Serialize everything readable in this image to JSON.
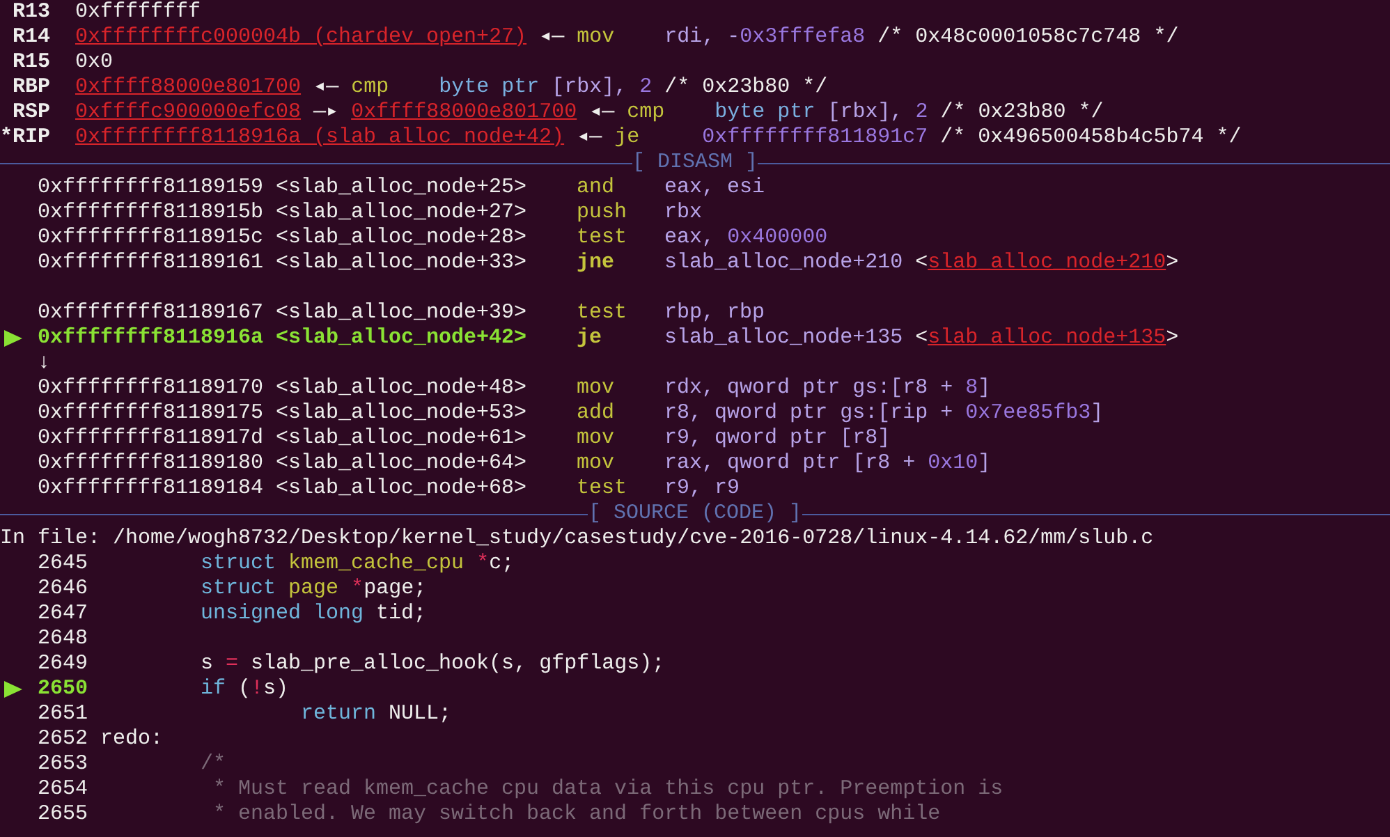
{
  "registers": [
    {
      "name": "R13",
      "segments": [
        {
          "kind": "plain",
          "text": "0xffffffff"
        }
      ]
    },
    {
      "name": "R14",
      "segments": [
        {
          "kind": "addr",
          "text": "0xffffffffc000004b (chardev_open+27)"
        },
        {
          "kind": "plain",
          "text": " ◂— "
        },
        {
          "kind": "mnem",
          "text": "mov"
        },
        {
          "kind": "reg",
          "text": "    rdi, -"
        },
        {
          "kind": "num",
          "text": "0x3fffefa8"
        },
        {
          "kind": "plain",
          "text": " /* 0x48c0001058c7c748 */"
        }
      ]
    },
    {
      "name": "R15",
      "segments": [
        {
          "kind": "plain",
          "text": "0x0"
        }
      ]
    },
    {
      "name": "RBP",
      "segments": [
        {
          "kind": "addr",
          "text": "0xffff88000e801700"
        },
        {
          "kind": "plain",
          "text": " ◂— "
        },
        {
          "kind": "mnem",
          "text": "cmp"
        },
        {
          "kind": "ptr",
          "text": "    byte ptr"
        },
        {
          "kind": "reg",
          "text": " [rbx], "
        },
        {
          "kind": "num",
          "text": "2"
        },
        {
          "kind": "plain",
          "text": " /* 0x23b80 */"
        }
      ]
    },
    {
      "name": "RSP",
      "segments": [
        {
          "kind": "addr",
          "text": "0xffffc900000efc08"
        },
        {
          "kind": "plain",
          "text": " —▸ "
        },
        {
          "kind": "addr",
          "text": "0xffff88000e801700"
        },
        {
          "kind": "plain",
          "text": " ◂— "
        },
        {
          "kind": "mnem",
          "text": "cmp"
        },
        {
          "kind": "ptr",
          "text": "    byte ptr"
        },
        {
          "kind": "reg",
          "text": " [rbx], "
        },
        {
          "kind": "num",
          "text": "2"
        },
        {
          "kind": "plain",
          "text": " /* 0x23b80 */"
        }
      ]
    },
    {
      "name": "*RIP",
      "segments": [
        {
          "kind": "addr",
          "text": "0xffffffff8118916a (slab_alloc_node+42)"
        },
        {
          "kind": "plain",
          "text": " ◂— "
        },
        {
          "kind": "mnem",
          "text": "je"
        },
        {
          "kind": "num",
          "text": "     0xffffffff811891c7"
        },
        {
          "kind": "plain",
          "text": " /* 0x496500458b4c5b74 */"
        }
      ]
    }
  ],
  "disasm": {
    "title": "[ DISASM ]",
    "lines": [
      {
        "kind": "instruction",
        "current": false,
        "address": "0xffffffff81189159",
        "symbol": "<slab_alloc_node+25>",
        "mnemonic": "and",
        "jump": false,
        "operands": [
          {
            "kind": "reg",
            "text": "eax, esi"
          }
        ]
      },
      {
        "kind": "instruction",
        "current": false,
        "address": "0xffffffff8118915b",
        "symbol": "<slab_alloc_node+27>",
        "mnemonic": "push",
        "jump": false,
        "operands": [
          {
            "kind": "reg",
            "text": "rbx"
          }
        ]
      },
      {
        "kind": "instruction",
        "current": false,
        "address": "0xffffffff8118915c",
        "symbol": "<slab_alloc_node+28>",
        "mnemonic": "test",
        "jump": false,
        "operands": [
          {
            "kind": "reg",
            "text": "eax, "
          },
          {
            "kind": "num",
            "text": "0x400000"
          }
        ]
      },
      {
        "kind": "instruction",
        "current": false,
        "address": "0xffffffff81189161",
        "symbol": "<slab_alloc_node+33>",
        "mnemonic": "jne",
        "jump": true,
        "operands": [
          {
            "kind": "reg",
            "text": "slab_alloc_node+210 "
          },
          {
            "kind": "plain",
            "text": "<"
          },
          {
            "kind": "addr",
            "text": "slab_alloc_node+210"
          },
          {
            "kind": "plain",
            "text": ">"
          }
        ]
      },
      {
        "kind": "blank"
      },
      {
        "kind": "instruction",
        "current": false,
        "address": "0xffffffff81189167",
        "symbol": "<slab_alloc_node+39>",
        "mnemonic": "test",
        "jump": false,
        "operands": [
          {
            "kind": "reg",
            "text": "rbp, rbp"
          }
        ]
      },
      {
        "kind": "instruction",
        "current": true,
        "address": "0xffffffff8118916a",
        "symbol": "<slab_alloc_node+42>",
        "mnemonic": "je",
        "jump": true,
        "operands": [
          {
            "kind": "reg",
            "text": "slab_alloc_node+135 "
          },
          {
            "kind": "plain",
            "text": "<"
          },
          {
            "kind": "addr",
            "text": "slab_alloc_node+135"
          },
          {
            "kind": "plain",
            "text": ">"
          }
        ]
      },
      {
        "kind": "branch",
        "text": "↓"
      },
      {
        "kind": "instruction",
        "current": false,
        "address": "0xffffffff81189170",
        "symbol": "<slab_alloc_node+48>",
        "mnemonic": "mov",
        "jump": false,
        "operands": [
          {
            "kind": "reg",
            "text": "rdx, qword ptr gs:[r8 + "
          },
          {
            "kind": "num",
            "text": "8"
          },
          {
            "kind": "reg",
            "text": "]"
          }
        ]
      },
      {
        "kind": "instruction",
        "current": false,
        "address": "0xffffffff81189175",
        "symbol": "<slab_alloc_node+53>",
        "mnemonic": "add",
        "jump": false,
        "operands": [
          {
            "kind": "reg",
            "text": "r8, qword ptr gs:[rip + "
          },
          {
            "kind": "num",
            "text": "0x7ee85fb3"
          },
          {
            "kind": "reg",
            "text": "]"
          }
        ]
      },
      {
        "kind": "instruction",
        "current": false,
        "address": "0xffffffff8118917d",
        "symbol": "<slab_alloc_node+61>",
        "mnemonic": "mov",
        "jump": false,
        "operands": [
          {
            "kind": "reg",
            "text": "r9, qword ptr [r8]"
          }
        ]
      },
      {
        "kind": "instruction",
        "current": false,
        "address": "0xffffffff81189180",
        "symbol": "<slab_alloc_node+64>",
        "mnemonic": "mov",
        "jump": false,
        "operands": [
          {
            "kind": "reg",
            "text": "rax, qword ptr [r8 + "
          },
          {
            "kind": "num",
            "text": "0x10"
          },
          {
            "kind": "reg",
            "text": "]"
          }
        ]
      },
      {
        "kind": "instruction",
        "current": false,
        "address": "0xffffffff81189184",
        "symbol": "<slab_alloc_node+68>",
        "mnemonic": "test",
        "jump": false,
        "operands": [
          {
            "kind": "reg",
            "text": "r9, r9"
          }
        ]
      }
    ]
  },
  "source": {
    "title": "[ SOURCE (CODE) ]",
    "file": "In file: /home/wogh8732/Desktop/kernel_study/casestudy/cve-2016-0728/linux-4.14.62/mm/slub.c",
    "lines": [
      {
        "number": "2645",
        "current": false,
        "code": [
          {
            "kind": "keyword",
            "text": "        struct"
          },
          {
            "kind": "type",
            "text": " kmem_cache_cpu"
          },
          {
            "kind": "operator",
            "text": " *"
          },
          {
            "kind": "plain",
            "text": "c;"
          }
        ]
      },
      {
        "number": "2646",
        "current": false,
        "code": [
          {
            "kind": "keyword",
            "text": "        struct"
          },
          {
            "kind": "type",
            "text": " page"
          },
          {
            "kind": "operator",
            "text": " *"
          },
          {
            "kind": "plain",
            "text": "page;"
          }
        ]
      },
      {
        "number": "2647",
        "current": false,
        "code": [
          {
            "kind": "keyword",
            "text": "        unsigned long"
          },
          {
            "kind": "plain",
            "text": " tid;"
          }
        ]
      },
      {
        "number": "2648",
        "current": false
      },
      {
        "number": "2649",
        "current": false,
        "code": [
          {
            "kind": "plain",
            "text": "        s "
          },
          {
            "kind": "operator",
            "text": "="
          },
          {
            "kind": "plain",
            "text": " slab_pre_alloc_hook(s, gfpflags);"
          }
        ]
      },
      {
        "number": "2650",
        "current": true,
        "code": [
          {
            "kind": "keyword",
            "text": "        if"
          },
          {
            "kind": "plain",
            "text": " ("
          },
          {
            "kind": "operator",
            "text": "!"
          },
          {
            "kind": "plain",
            "text": "s)"
          }
        ]
      },
      {
        "number": "2651",
        "current": false,
        "code": [
          {
            "kind": "keyword",
            "text": "                return"
          },
          {
            "kind": "plain",
            "text": " NULL;"
          }
        ]
      },
      {
        "number": "2652",
        "current": false,
        "code": [
          {
            "kind": "plain",
            "text": "redo:"
          }
        ]
      },
      {
        "number": "2653",
        "current": false,
        "code": [
          {
            "kind": "comment",
            "text": "        /*"
          }
        ]
      },
      {
        "number": "2654",
        "current": false,
        "code": [
          {
            "kind": "comment",
            "text": "         * Must read kmem_cache cpu data via this cpu ptr. Preemption is"
          }
        ]
      },
      {
        "number": "2655",
        "current": false,
        "code": [
          {
            "kind": "comment",
            "text": "         * enabled. We may switch back and forth between cpus while"
          }
        ]
      }
    ]
  }
}
